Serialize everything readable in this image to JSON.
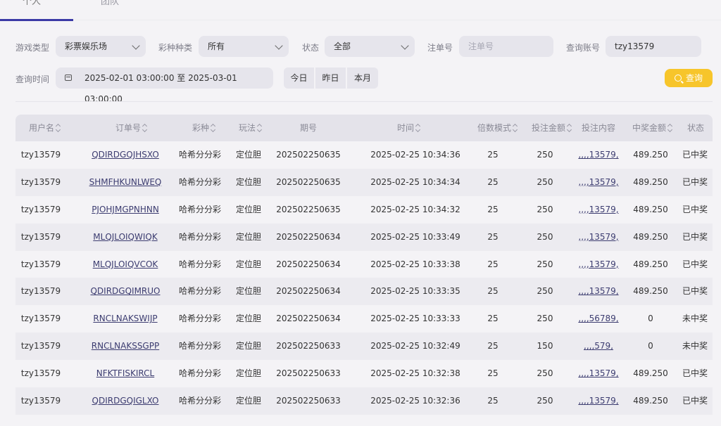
{
  "tabs": {
    "personal": "个人",
    "team": "团队"
  },
  "filters": {
    "game_type": {
      "label": "游戏类型",
      "value": "彩票娱乐场"
    },
    "lottery_kind": {
      "label": "彩种种类",
      "value": "所有"
    },
    "status": {
      "label": "状态",
      "value": "全部"
    },
    "order_no": {
      "label": "注单号",
      "placeholder": "注单号"
    },
    "account": {
      "label": "查询账号",
      "value": "tzy13579"
    },
    "time": {
      "label": "查询时间",
      "value": "2025-02-01 03:00:00 至 2025-03-01 03:00:00"
    },
    "quick": {
      "today": "今日",
      "yesterday": "昨日",
      "month": "本月"
    },
    "search_button": "查询"
  },
  "table": {
    "headers": {
      "username": "用户名",
      "order": "订单号",
      "lottery": "彩种",
      "play": "玩法",
      "period": "期号",
      "time": "时间",
      "multiplier": "倍数模式",
      "amount": "投注金额",
      "content": "投注内容",
      "prize": "中奖金额",
      "status": "状态"
    },
    "rows": [
      {
        "username": "tzy13579",
        "order": "QDIRDGQJHSXO",
        "lottery": "哈希分分彩",
        "play": "定位胆",
        "period": "202502250635",
        "time": "2025-02-25 10:34:36",
        "multiplier": "25",
        "amount": "250",
        "content": ",,,,13579,",
        "prize": "489.250",
        "status": "已中奖"
      },
      {
        "username": "tzy13579",
        "order": "SHMFHKUNLWEQ",
        "lottery": "哈希分分彩",
        "play": "定位胆",
        "period": "202502250635",
        "time": "2025-02-25 10:34:34",
        "multiplier": "25",
        "amount": "250",
        "content": ",,,,13579,",
        "prize": "489.250",
        "status": "已中奖"
      },
      {
        "username": "tzy13579",
        "order": "PJOHJMGPNHNN",
        "lottery": "哈希分分彩",
        "play": "定位胆",
        "period": "202502250635",
        "time": "2025-02-25 10:34:32",
        "multiplier": "25",
        "amount": "250",
        "content": ",,,,13579,",
        "prize": "489.250",
        "status": "已中奖"
      },
      {
        "username": "tzy13579",
        "order": "MLQJLOIQWIQK",
        "lottery": "哈希分分彩",
        "play": "定位胆",
        "period": "202502250634",
        "time": "2025-02-25 10:33:49",
        "multiplier": "25",
        "amount": "250",
        "content": ",,,,13579,",
        "prize": "489.250",
        "status": "已中奖"
      },
      {
        "username": "tzy13579",
        "order": "MLQJLOIQVCOK",
        "lottery": "哈希分分彩",
        "play": "定位胆",
        "period": "202502250634",
        "time": "2025-02-25 10:33:38",
        "multiplier": "25",
        "amount": "250",
        "content": ",,,,13579,",
        "prize": "489.250",
        "status": "已中奖"
      },
      {
        "username": "tzy13579",
        "order": "QDIRDGQIMRUO",
        "lottery": "哈希分分彩",
        "play": "定位胆",
        "period": "202502250634",
        "time": "2025-02-25 10:33:35",
        "multiplier": "25",
        "amount": "250",
        "content": ",,,,13579,",
        "prize": "489.250",
        "status": "已中奖"
      },
      {
        "username": "tzy13579",
        "order": "RNCLNAKSWIJP",
        "lottery": "哈希分分彩",
        "play": "定位胆",
        "period": "202502250634",
        "time": "2025-02-25 10:33:33",
        "multiplier": "25",
        "amount": "250",
        "content": ",,,,56789,",
        "prize": "0",
        "status": "未中奖"
      },
      {
        "username": "tzy13579",
        "order": "RNCLNAKSSGPP",
        "lottery": "哈希分分彩",
        "play": "定位胆",
        "period": "202502250633",
        "time": "2025-02-25 10:32:49",
        "multiplier": "25",
        "amount": "150",
        "content": ",,,,579,",
        "prize": "0",
        "status": "未中奖"
      },
      {
        "username": "tzy13579",
        "order": "NFKTFISKIRCL",
        "lottery": "哈希分分彩",
        "play": "定位胆",
        "period": "202502250633",
        "time": "2025-02-25 10:32:38",
        "multiplier": "25",
        "amount": "250",
        "content": ",,,,13579,",
        "prize": "489.250",
        "status": "已中奖"
      },
      {
        "username": "tzy13579",
        "order": "QDIRDGQIGLXO",
        "lottery": "哈希分分彩",
        "play": "定位胆",
        "period": "202502250633",
        "time": "2025-02-25 10:32:36",
        "multiplier": "25",
        "amount": "250",
        "content": ",,,,13579,",
        "prize": "489.250",
        "status": "已中奖"
      }
    ]
  }
}
